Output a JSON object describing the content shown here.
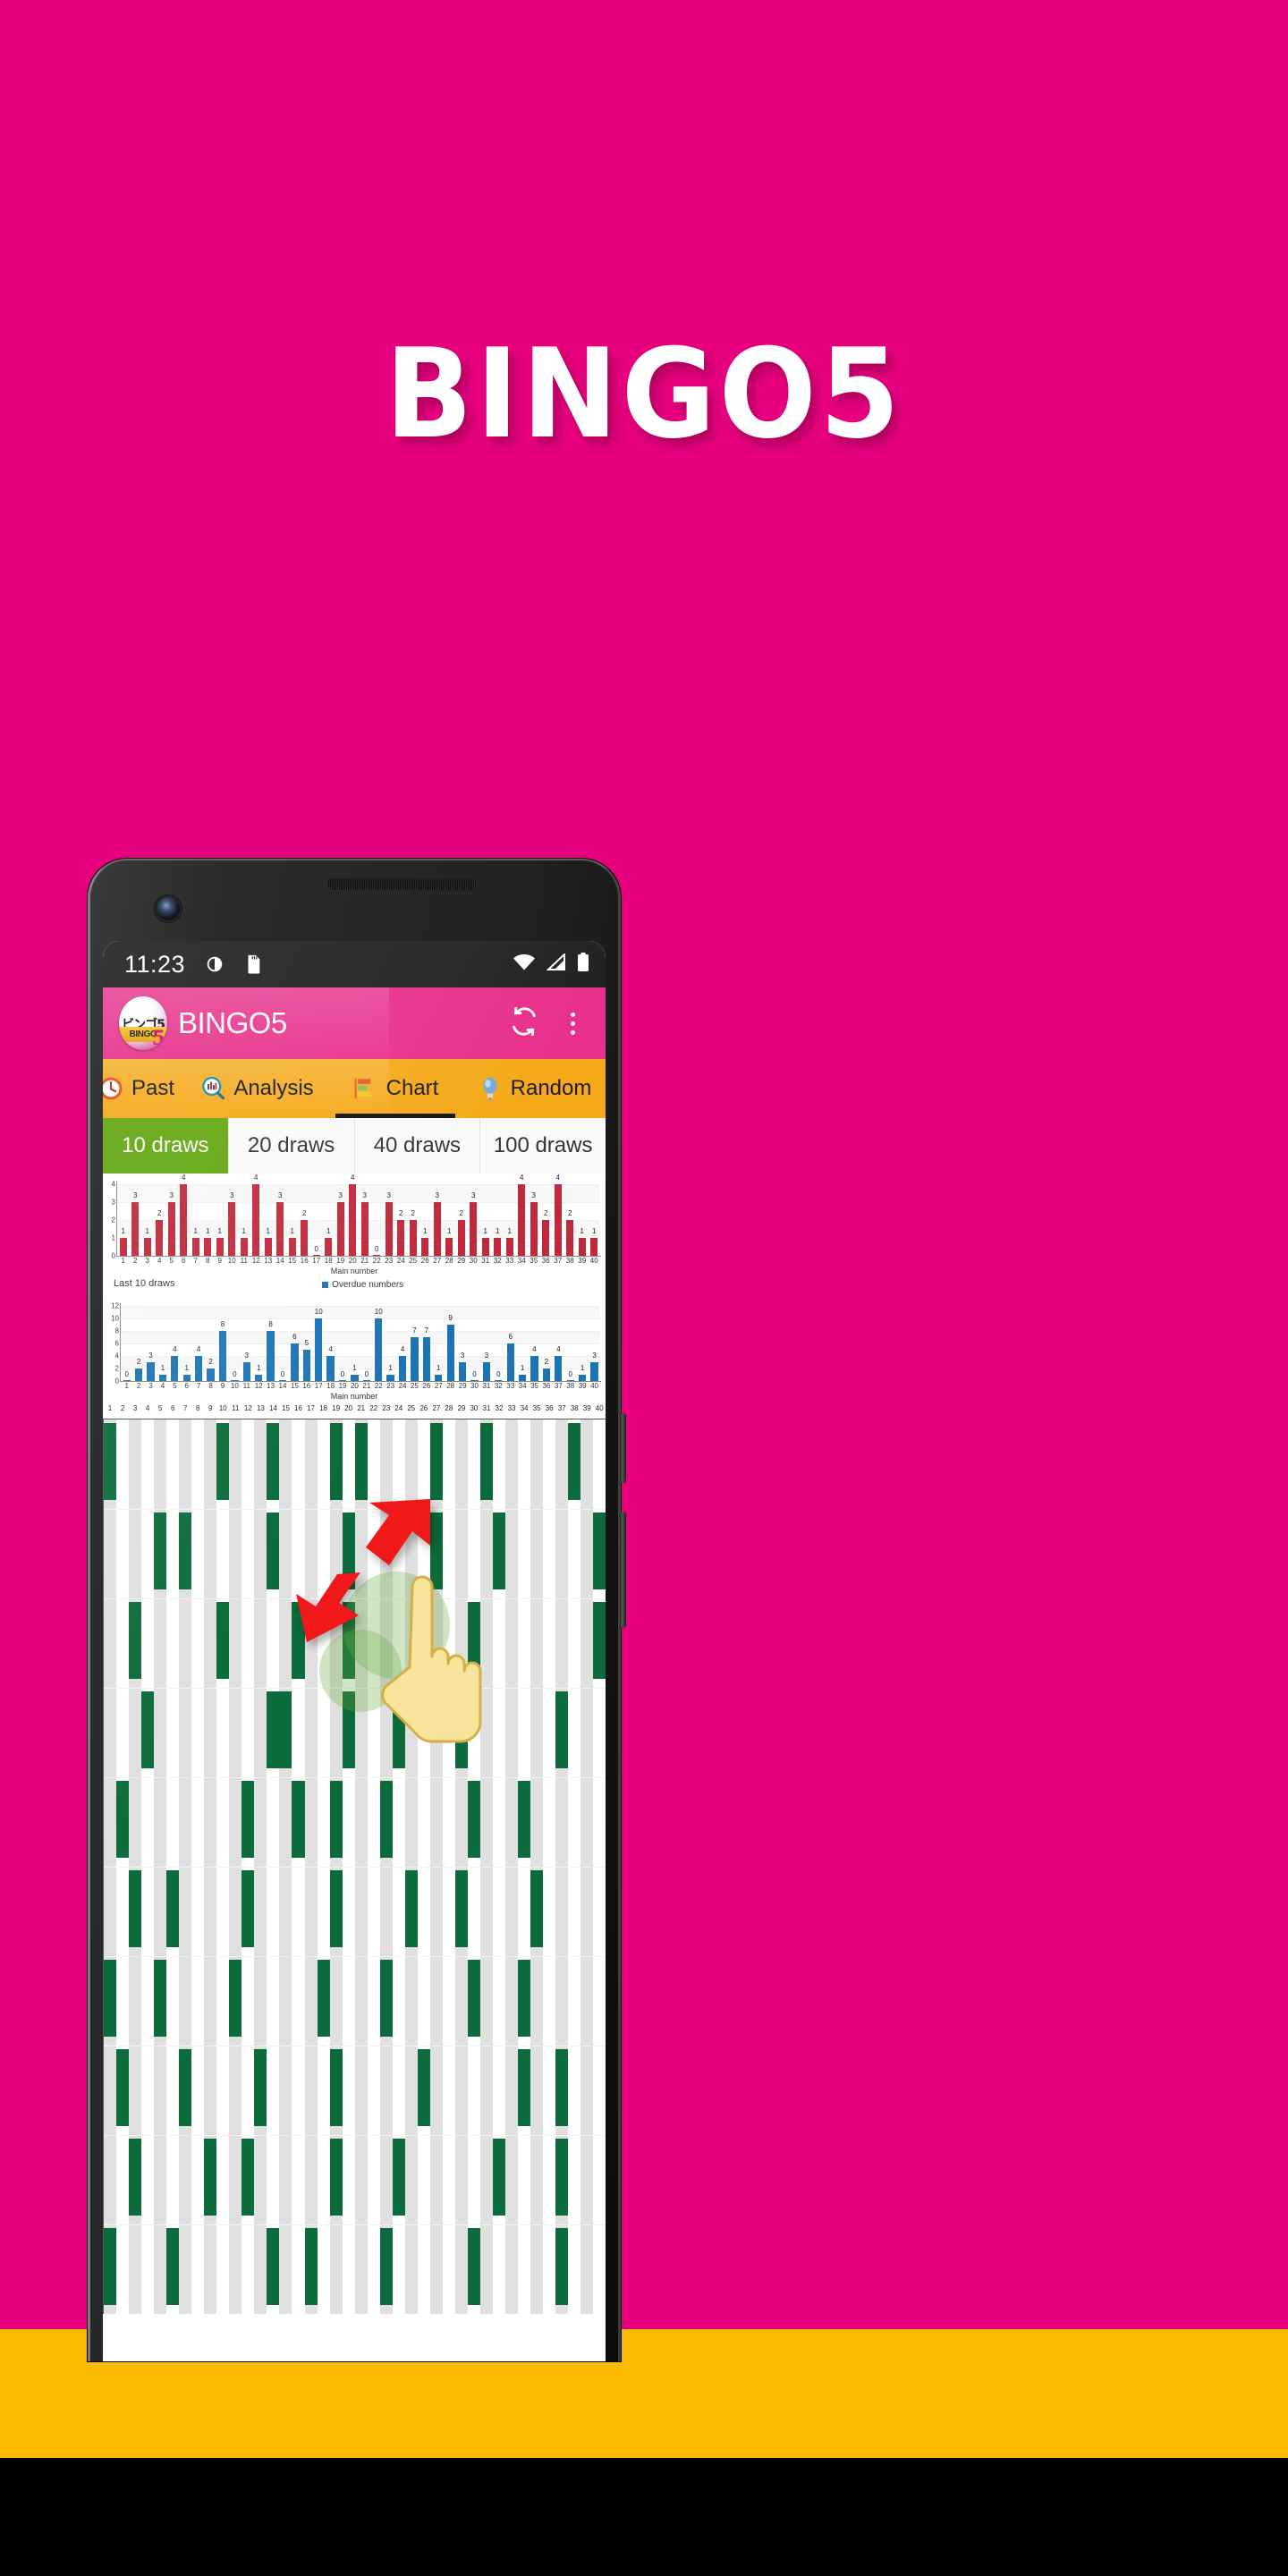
{
  "hero": {
    "title": "BINGO5",
    "background_color": "#E6007E",
    "title_color": "#FFFFFF"
  },
  "bottom_bar": {
    "amber_color": "#FBBA00",
    "black_color": "#000000"
  },
  "phone": {
    "status_bar": {
      "time": "11:23",
      "icons": [
        "vibrate-icon",
        "sd-card-icon"
      ],
      "right_icons": [
        "wifi-icon",
        "signal-icon",
        "battery-icon"
      ],
      "background_color": "#222222"
    },
    "app_bar": {
      "title": "BINGO5",
      "logo_jp": "ビンゴ5",
      "logo_band": "BINGO",
      "logo_five": "5",
      "background_color": "#E8308A",
      "actions": [
        {
          "name": "refresh-button",
          "label": "refresh-icon"
        },
        {
          "name": "overflow-menu-button",
          "label": "more-vert-icon"
        }
      ]
    },
    "tabs": {
      "background_color": "#F5A919",
      "active": "Chart",
      "items": [
        {
          "label": "Past",
          "icon": "clock-icon"
        },
        {
          "label": "Analysis",
          "icon": "magnifier-chart-icon"
        },
        {
          "label": "Chart",
          "icon": "bar-chart-icon"
        },
        {
          "label": "Random",
          "icon": "lightbulb-icon"
        }
      ]
    },
    "draw_selector": {
      "active": "10 draws",
      "active_color": "#64A812",
      "options": [
        "10 draws",
        "20 draws",
        "40 draws",
        "100 draws"
      ]
    }
  },
  "chart_data": [
    {
      "type": "bar",
      "name": "frequency-chart",
      "title": "",
      "xlabel": "Main number",
      "ylabel": "",
      "ylim": [
        0,
        4
      ],
      "yticks": [
        0,
        1,
        2,
        3,
        4
      ],
      "bar_color": "#C0293B",
      "categories": [
        1,
        2,
        3,
        4,
        5,
        6,
        7,
        8,
        9,
        10,
        11,
        12,
        13,
        14,
        15,
        16,
        17,
        18,
        19,
        20,
        21,
        22,
        23,
        24,
        25,
        26,
        27,
        28,
        29,
        30,
        31,
        32,
        33,
        34,
        35,
        36,
        37,
        38,
        39,
        40
      ],
      "values": [
        1,
        3,
        1,
        2,
        3,
        4,
        1,
        1,
        1,
        3,
        1,
        4,
        1,
        3,
        1,
        2,
        0,
        1,
        3,
        4,
        3,
        0,
        3,
        2,
        2,
        1,
        3,
        1,
        2,
        3,
        1,
        1,
        1,
        4,
        3,
        2,
        4,
        2,
        1,
        1
      ],
      "grid": true,
      "legend": ""
    },
    {
      "type": "bar",
      "name": "overdue-chart",
      "title": "Last 10 draws",
      "xlabel": "Main number",
      "ylabel": "",
      "ylim": [
        0,
        12
      ],
      "yticks": [
        0,
        2,
        4,
        6,
        8,
        10,
        12
      ],
      "bar_color": "#1D74B5",
      "legend": "Overdue numbers",
      "legend_position": "top-center",
      "categories": [
        1,
        2,
        3,
        4,
        5,
        6,
        7,
        8,
        9,
        10,
        11,
        12,
        13,
        14,
        15,
        16,
        17,
        18,
        19,
        20,
        21,
        22,
        23,
        24,
        25,
        26,
        27,
        28,
        29,
        30,
        31,
        32,
        33,
        34,
        35,
        36,
        37,
        38,
        39,
        40
      ],
      "values": [
        0,
        2,
        3,
        1,
        4,
        1,
        4,
        2,
        8,
        0,
        3,
        1,
        8,
        0,
        6,
        5,
        10,
        4,
        0,
        1,
        0,
        10,
        1,
        4,
        7,
        7,
        1,
        9,
        3,
        0,
        3,
        0,
        6,
        1,
        4,
        2,
        4,
        0,
        1,
        3
      ],
      "grid": true
    },
    {
      "type": "heatmap",
      "name": "draw-history-grid",
      "title": "",
      "xlabel": "",
      "on_color": "#0B6B3A",
      "odd_column_color": "#E0E0E0",
      "even_column_color": "#FFFFFF",
      "categories": [
        1,
        2,
        3,
        4,
        5,
        6,
        7,
        8,
        9,
        10,
        11,
        12,
        13,
        14,
        15,
        16,
        17,
        18,
        19,
        20,
        21,
        22,
        23,
        24,
        25,
        26,
        27,
        28,
        29,
        30,
        31,
        32,
        33,
        34,
        35,
        36,
        37,
        38,
        39,
        40
      ],
      "rows": [
        [
          1,
          10,
          14,
          19,
          21,
          27,
          31,
          38
        ],
        [
          5,
          7,
          14,
          20,
          27,
          32,
          40
        ],
        [
          3,
          10,
          16,
          20,
          26,
          30,
          40
        ],
        [
          4,
          14,
          15,
          20,
          24,
          29,
          37
        ],
        [
          2,
          12,
          16,
          19,
          23,
          30,
          34
        ],
        [
          3,
          6,
          12,
          19,
          25,
          29,
          35
        ],
        [
          1,
          5,
          11,
          18,
          23,
          30,
          34
        ],
        [
          2,
          7,
          13,
          19,
          26,
          34,
          37
        ],
        [
          3,
          9,
          12,
          19,
          24,
          32,
          37
        ],
        [
          1,
          6,
          14,
          17,
          23,
          30,
          37
        ]
      ]
    }
  ],
  "overlays": {
    "arrow_color": "#F01818",
    "ripple_color": "rgba(104,168,64,0.30)",
    "hand_cursor": "pointing-hand-icon"
  }
}
